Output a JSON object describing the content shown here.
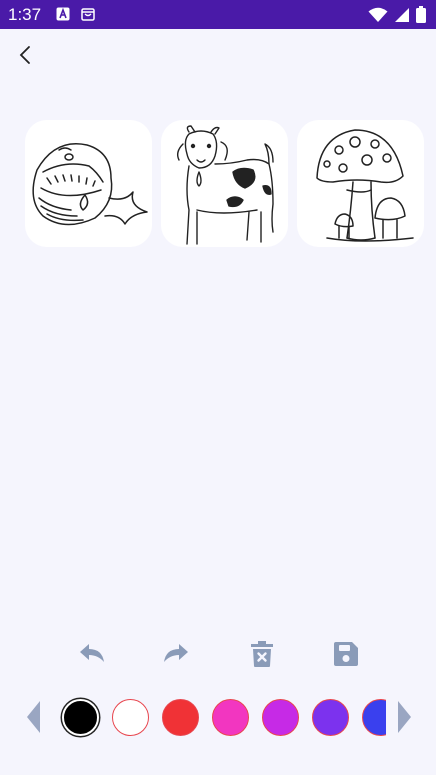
{
  "status_bar": {
    "time": "1:37",
    "background": "#4a1aa8",
    "left_icons": [
      "text-a-icon",
      "store-icon"
    ],
    "right_icons": [
      "wifi-icon",
      "signal-icon",
      "battery-icon"
    ]
  },
  "nav": {
    "back_icon": "chevron-left-icon"
  },
  "gallery": {
    "items": [
      {
        "name": "whale",
        "icon": "whale-outline-icon"
      },
      {
        "name": "goat",
        "icon": "goat-outline-icon"
      },
      {
        "name": "mushroom",
        "icon": "mushroom-outline-icon"
      }
    ]
  },
  "toolbar": {
    "icon_color": "#8a9bb8",
    "tools": [
      {
        "name": "undo",
        "icon": "undo-icon"
      },
      {
        "name": "redo",
        "icon": "redo-icon"
      },
      {
        "name": "delete",
        "icon": "trash-icon"
      },
      {
        "name": "save",
        "icon": "save-icon"
      }
    ]
  },
  "palette": {
    "arrow_color": "#9aa6c2",
    "selected": "#000000",
    "colors": [
      "#000000",
      "#ffffff",
      "#f03236",
      "#f236c0",
      "#c62ae6",
      "#7c32ee",
      "#3a40ee"
    ]
  }
}
